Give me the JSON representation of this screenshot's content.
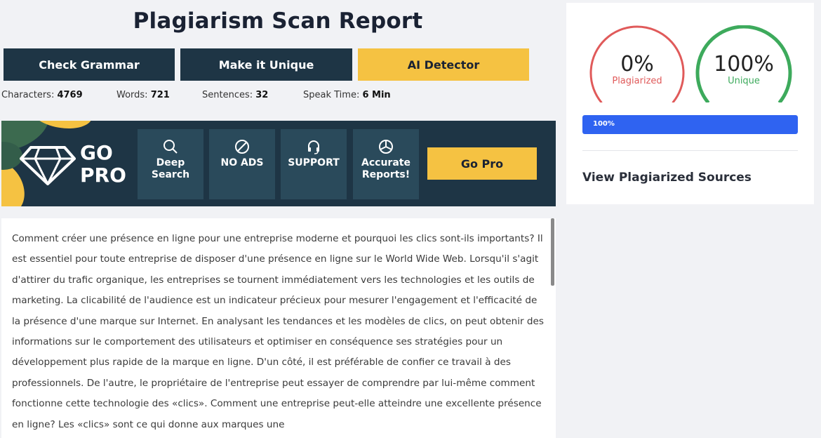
{
  "report": {
    "title": "Plagiarism Scan Report"
  },
  "actions": {
    "check_grammar": "Check Grammar",
    "make_unique": "Make it Unique",
    "ai_detector": "AI Detector"
  },
  "stats": [
    {
      "label": "Characters: ",
      "value": "4769"
    },
    {
      "label": "Words: ",
      "value": "721"
    },
    {
      "label": "Sentences: ",
      "value": "32"
    },
    {
      "label": "Speak Time: ",
      "value": "6 Min"
    }
  ],
  "promo": {
    "go": "GO",
    "pro": "PRO",
    "features": [
      {
        "icon": "search-icon",
        "label": "Deep Search"
      },
      {
        "icon": "no-ads-icon",
        "label": "NO ADS"
      },
      {
        "icon": "headset-icon",
        "label": "SUPPORT"
      },
      {
        "icon": "pie-chart-icon",
        "label": "Accurate Reports!"
      }
    ],
    "button": "Go Pro"
  },
  "content": {
    "text": "Comment créer une présence en ligne pour une entreprise moderne et pourquoi les clics sont-ils importants? Il est essentiel pour toute entreprise de disposer d'une présence en ligne sur le World Wide Web. Lorsqu'il s'agit d'attirer du trafic organique, les entreprises se tournent immédiatement vers les technologies et les outils de marketing. La clicabilité de l'audience est un indicateur précieux pour mesurer l'engagement et l'efficacité de la présence d'une marque sur Internet. En analysant les tendances et les modèles de clics, on peut obtenir des informations sur le comportement des utilisateurs et optimiser en conséquence ses stratégies pour un développement plus rapide de la marque en ligne. D'un côté, il est préférable de confier ce travail à des professionnels. De l'autre, le propriétaire de l'entreprise peut essayer de comprendre par lui-même comment fonctionne cette technologie des «clics». Comment une entreprise peut-elle atteindre une excellente présence en ligne? Les «clics» sont ce qui donne aux marques une"
  },
  "results": {
    "plagiarized": {
      "value": "0%",
      "label": "Plagiarized",
      "color": "#e05a5a",
      "fraction": 0
    },
    "unique": {
      "value": "100%",
      "label": "Unique",
      "color": "#3daa5c",
      "fraction": 1
    },
    "progress": {
      "label": "100%",
      "percent": 100,
      "color": "#2f63f1"
    },
    "view_sources": "View Plagiarized Sources"
  }
}
